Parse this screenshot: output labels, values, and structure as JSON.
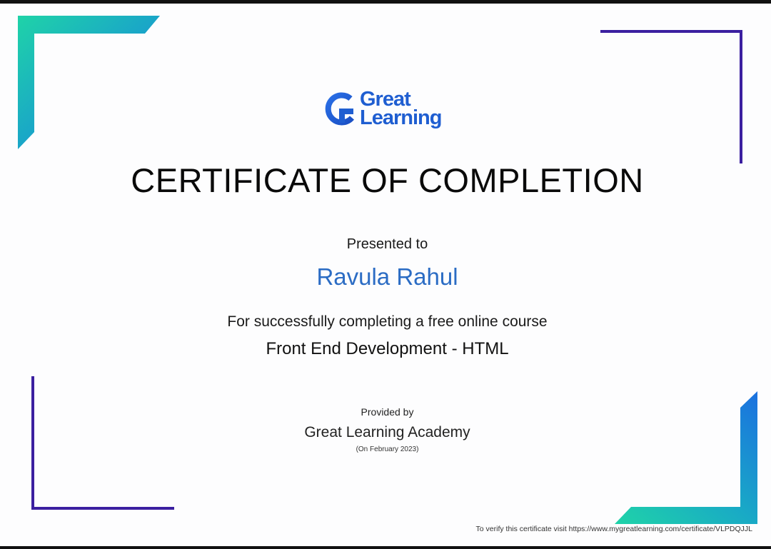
{
  "logo": {
    "brand_word_1": "Great",
    "brand_word_2": "Learning",
    "brand_color": "#1f5ed1",
    "icon": "great-learning-g-icon"
  },
  "certificate": {
    "title": "CERTIFICATE OF COMPLETION",
    "presented_label": "Presented to",
    "recipient_name": "Ravula Rahul",
    "reason": "For successfully completing a free online course",
    "course_name": "Front End Development - HTML",
    "provided_label": "Provided by",
    "provider": "Great Learning Academy",
    "date": "(On February 2023)",
    "verify_text": "To verify this certificate visit https://www.mygreatlearning.com/certificate/VLPDQJJL"
  },
  "colors": {
    "recipient": "#2b6cc4",
    "gradient_teal": "#1fd1a6",
    "gradient_blue": "#1a6fe0",
    "frame_purple": "#3b1fa0"
  }
}
